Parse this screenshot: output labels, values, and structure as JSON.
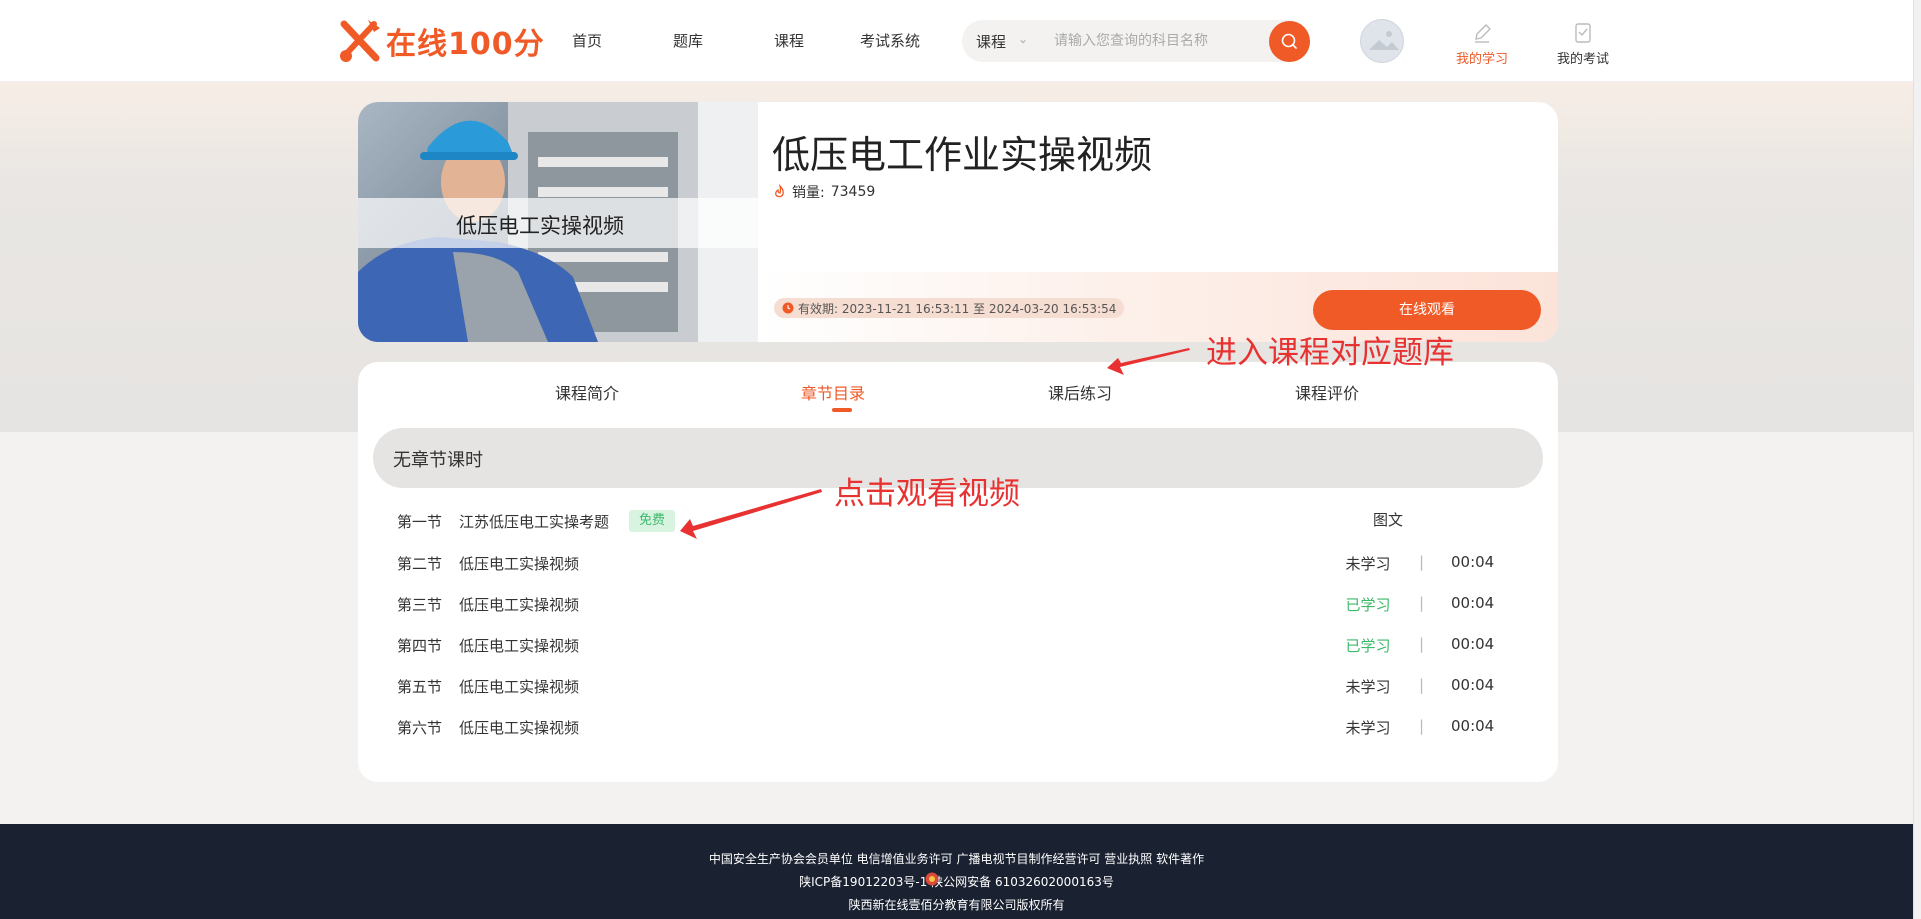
{
  "header": {
    "logo_text": "在线100分",
    "nav": [
      "首页",
      "题库",
      "课程",
      "考试系统"
    ],
    "search": {
      "category": "课程",
      "placeholder": "请输入您查询的科目名称"
    },
    "my_study": "我的学习",
    "my_exam": "我的考试"
  },
  "course": {
    "thumb_label": "低压电工实操视频",
    "title": "低压电工作业实操视频",
    "sales_label": "销量:",
    "sales_value": "73459",
    "validity": "有效期: 2023-11-21 16:53:11 至 2024-03-20 16:53:54",
    "watch_button": "在线观看"
  },
  "tabs": [
    "课程简介",
    "章节目录",
    "课后练习",
    "课程评价"
  ],
  "active_tab": "章节目录",
  "section_title": "无章节课时",
  "lessons": [
    {
      "no": "第一节",
      "name": "江苏低压电工实操考题",
      "badge": "免费",
      "kind": "图文"
    },
    {
      "no": "第二节",
      "name": "低压电工实操视频",
      "status": "未学习",
      "sep": "|",
      "duration": "00:04"
    },
    {
      "no": "第三节",
      "name": "低压电工实操视频",
      "status": "已学习",
      "sep": "|",
      "duration": "00:04"
    },
    {
      "no": "第四节",
      "name": "低压电工实操视频",
      "status": "已学习",
      "sep": "|",
      "duration": "00:04"
    },
    {
      "no": "第五节",
      "name": "低压电工实操视频",
      "status": "未学习",
      "sep": "|",
      "duration": "00:04"
    },
    {
      "no": "第六节",
      "name": "低压电工实操视频",
      "status": "未学习",
      "sep": "|",
      "duration": "00:04"
    }
  ],
  "annotations": {
    "exercise": "进入课程对应题库",
    "watch": "点击观看视频"
  },
  "footer": {
    "line1": "中国安全生产协会会员单位  电信增值业务许可  广播电视节目制作经营许可  营业执照  软件著作",
    "line2": "陕ICP备19012203号-1  陕公网安备 61032602000163号",
    "line3": "陕西新在线壹佰分教育有限公司版权所有"
  },
  "colors": {
    "accent": "#ef5a27",
    "learned": "#3cb96a",
    "annotation": "#e83232",
    "footer_bg": "#1a2131"
  }
}
